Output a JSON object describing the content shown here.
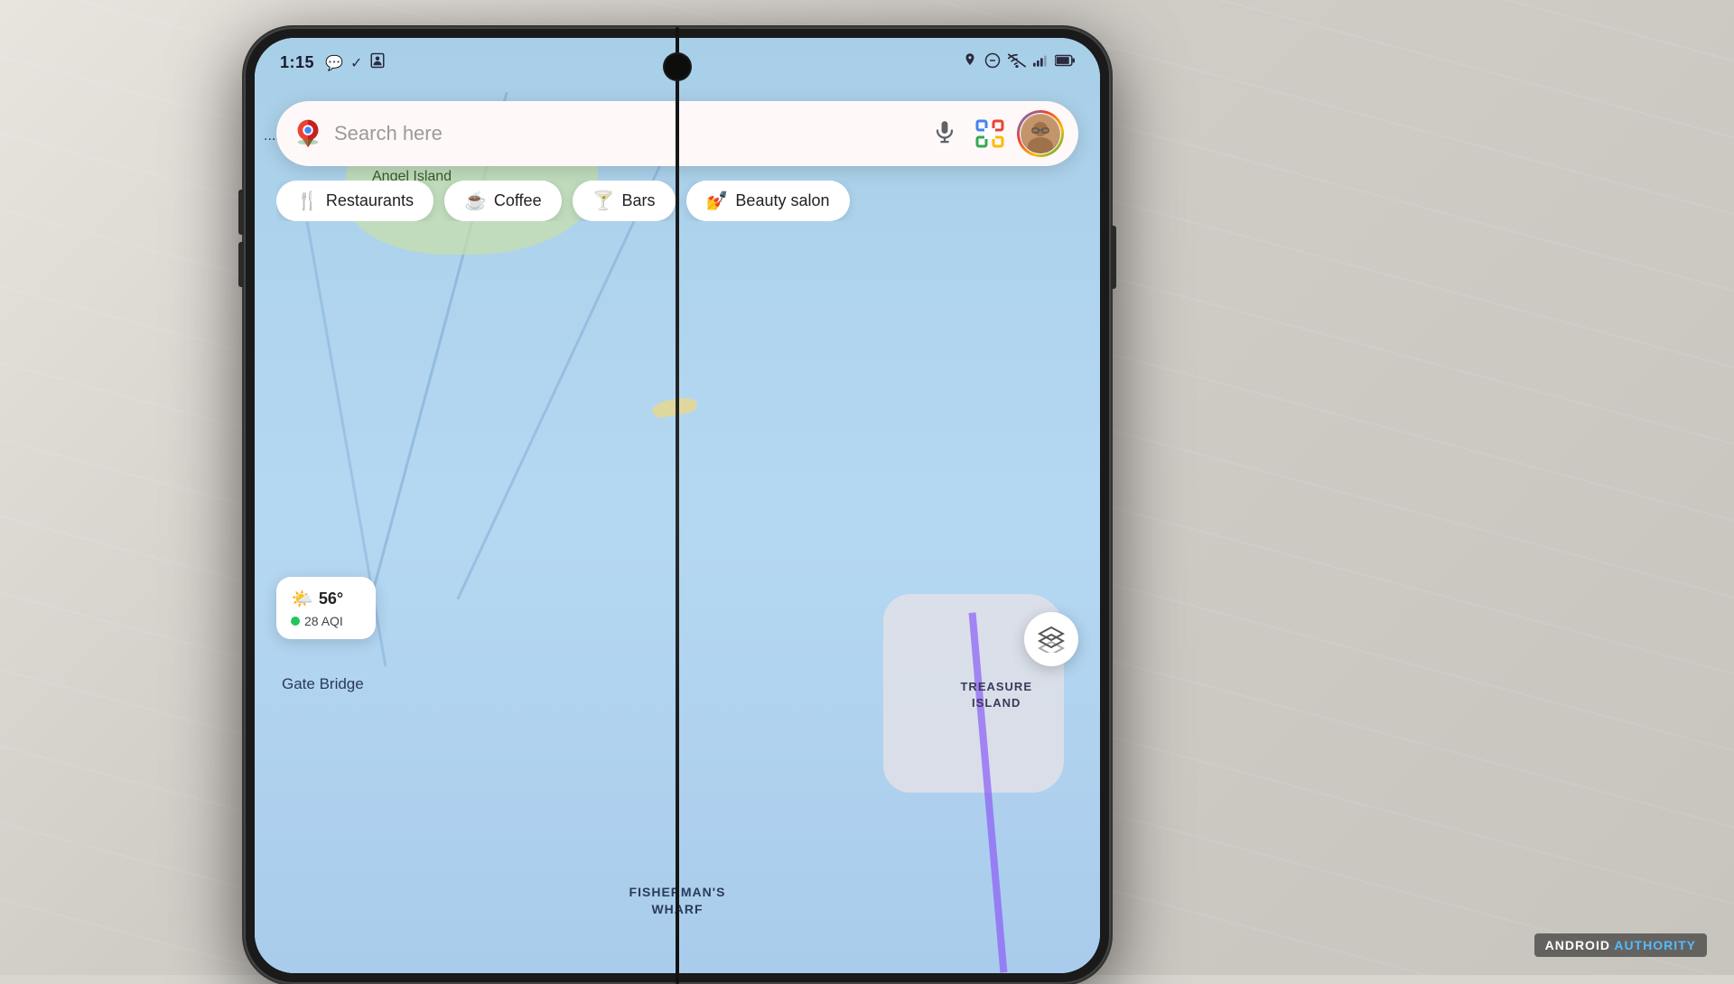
{
  "background": {
    "color": "#d8d5cf"
  },
  "status_bar": {
    "time": "1:15",
    "left_icons": [
      "message-icon",
      "check-icon",
      "contact-icon"
    ],
    "right_icons": [
      "location-icon",
      "dnd-icon",
      "wifi-icon",
      "signal-icon",
      "battery-icon"
    ]
  },
  "search_bar": {
    "placeholder": "Search here",
    "voice_label": "voice-search",
    "lens_label": "lens-search",
    "avatar_label": "user-avatar"
  },
  "category_pills": [
    {
      "id": "restaurants",
      "label": "Restaurants",
      "icon": "🍴"
    },
    {
      "id": "coffee",
      "label": "Coffee",
      "icon": "☕"
    },
    {
      "id": "bars",
      "label": "Bars",
      "icon": "🍸"
    },
    {
      "id": "beauty",
      "label": "Beauty salon",
      "icon": "💅"
    }
  ],
  "map": {
    "labels": {
      "tiburon": "...buron",
      "angel_island": "Angel Island",
      "gate_bridge": "Gate Bridge",
      "fishermans_wharf_line1": "FISHERMAN'S",
      "fishermans_wharf_line2": "WHARF",
      "treasure_island_line1": "TREASURE",
      "treasure_island_line2": "ISLAND"
    }
  },
  "weather": {
    "temperature": "56°",
    "aqi": "28 AQI",
    "icon": "🌤️"
  },
  "layers_button": {
    "label": "layers"
  },
  "watermark": {
    "brand": "ANDROID",
    "suffix": "AUTHORITY"
  }
}
